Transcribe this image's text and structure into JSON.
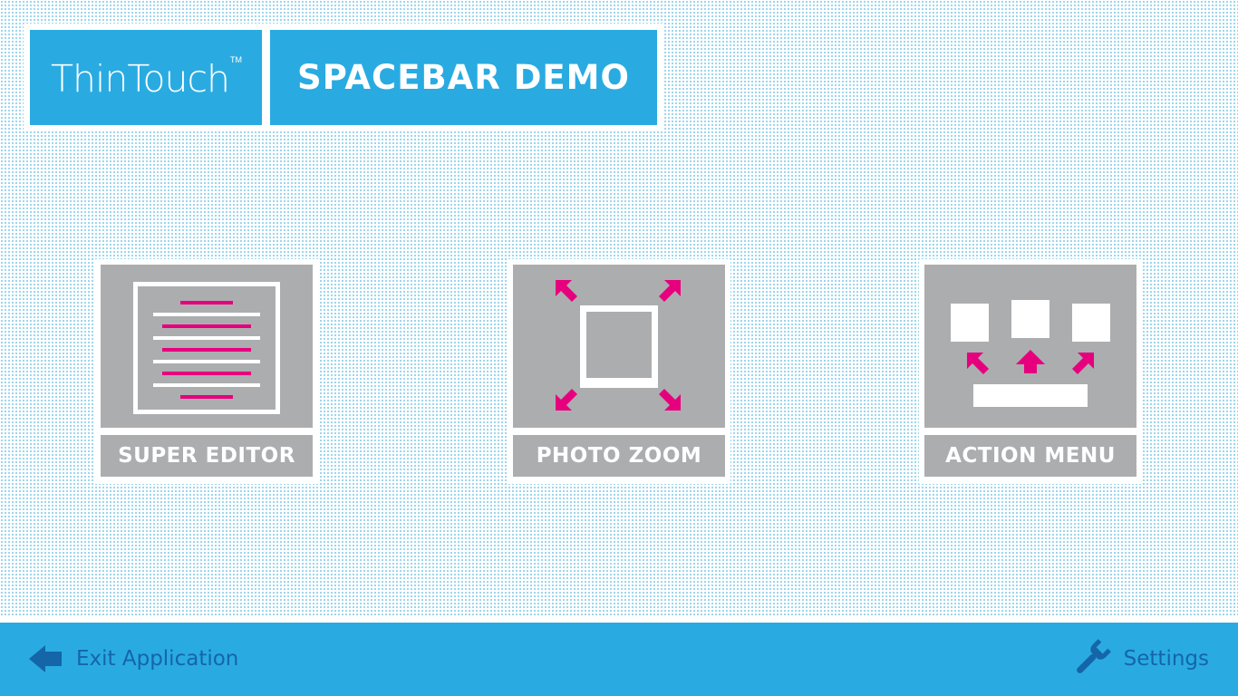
{
  "header": {
    "logo_text": "ThinTouch",
    "logo_tm": "TM",
    "title": "SPACEBAR DEMO"
  },
  "tiles": [
    {
      "label": "SUPER EDITOR",
      "icon": "document-lines-icon"
    },
    {
      "label": "PHOTO ZOOM",
      "icon": "photo-zoom-icon"
    },
    {
      "label": "ACTION MENU",
      "icon": "action-menu-icon"
    }
  ],
  "footer": {
    "exit_label": "Exit Application",
    "exit_icon": "arrow-left-icon",
    "settings_label": "Settings",
    "settings_icon": "wrench-icon"
  },
  "colors": {
    "brand_blue": "#29abe2",
    "tile_gray": "#acadaf",
    "accent_magenta": "#e6007e",
    "footer_text": "#1565a9"
  }
}
